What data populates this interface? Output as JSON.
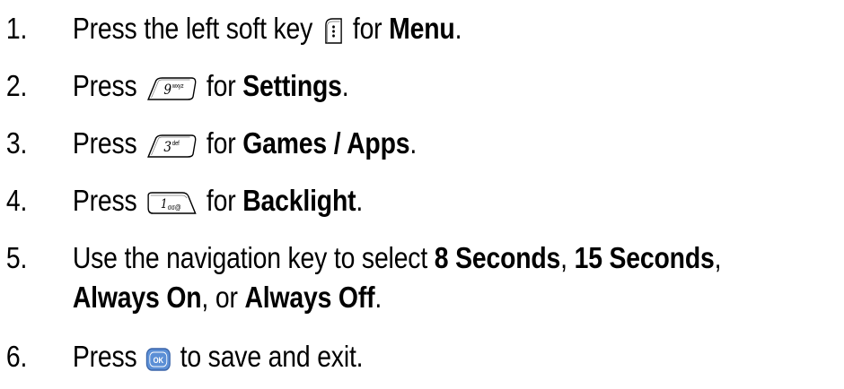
{
  "steps": [
    {
      "num": "1.",
      "before": "Press the left soft key",
      "icon": "left-soft-key-icon",
      "after": "for",
      "bold": "Menu",
      "end": "."
    },
    {
      "num": "2.",
      "before": "Press",
      "icon": "key-9-wxyz-icon",
      "key_label": "9",
      "key_sub": "wxyz",
      "after": "for",
      "bold": "Settings",
      "end": "."
    },
    {
      "num": "3.",
      "before": "Press",
      "icon": "key-3-def-icon",
      "key_label": "3",
      "key_sub": "def",
      "after": "for",
      "bold": "Games / Apps",
      "end": "."
    },
    {
      "num": "4.",
      "before": "Press",
      "icon": "key-1-voicemail-icon",
      "key_label": "1",
      "key_sub": "σσ@",
      "after": "for",
      "bold": "Backlight",
      "end": "."
    },
    {
      "num": "5.",
      "line1_before": "Use the navigation key to select",
      "opt1": "8 Seconds",
      "comma1": ",",
      "opt2": "15 Seconds",
      "comma2": ",",
      "opt3": "Always On",
      "comma3": ", or",
      "opt4": "Always Off",
      "end": "."
    },
    {
      "num": "6.",
      "before": "Press",
      "icon": "ok-key-icon",
      "key_label": "OK",
      "after": "to save and exit."
    }
  ],
  "colors": {
    "text": "#000000",
    "ok_key": "#5b8fd6",
    "key_outline": "#000000"
  }
}
